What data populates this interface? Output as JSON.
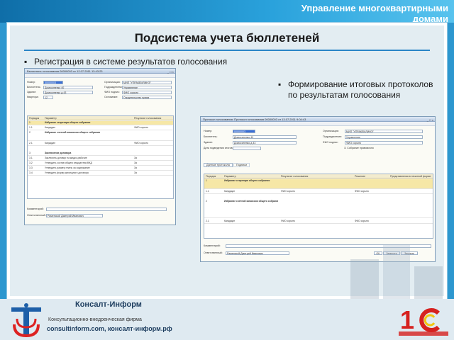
{
  "header": {
    "title": "Управление многоквартирными домами"
  },
  "slide": {
    "title": "Подсистема учета бюллетеней",
    "bullet1": "Регистрация в системе результатов голосования",
    "bullet2": "Формирование итоговых протоколов по результатам голосования"
  },
  "window1": {
    "title": "Бюллетень голосования 00000003 от 12.07.2011 13:43:23",
    "fields": [
      {
        "label": "Номер:",
        "value": "00000003"
      },
      {
        "label": "Бюллетень:",
        "value": "Домосипенко 40"
      },
      {
        "label": "Здание:",
        "value": "Домосипенко д.43"
      },
      {
        "label": "Квартира:",
        "value": "12"
      }
    ],
    "right_fields": [
      {
        "label": "Организация:",
        "value": "МИП \"УПРАКЕМЛИНЭ\""
      },
      {
        "label": "Подразделение:",
        "value": "Управление"
      },
      {
        "label": "ФИО подпис:",
        "value": "ФИО сорыто"
      },
      {
        "label": "Основание:",
        "value": "Свидетельство права"
      }
    ],
    "columns": [
      "Порядок",
      "Параметр",
      "Результат голосования"
    ],
    "rows": [
      {
        "num": "1",
        "text": "Избрание секретаря общего собрания"
      },
      {
        "num": "1.1",
        "text": "Кандидат",
        "result": "ФИО сорыто"
      },
      {
        "num": "2",
        "text": "Избрание счетной комиссии общего собрания"
      },
      {
        "num": "2.1",
        "text": "Кандидат",
        "result": "ФИО сорыто"
      },
      {
        "num": "3",
        "text": "Заключение договора"
      },
      {
        "num": "3.1",
        "text": "Заключить договор на жидко-рабочие",
        "result": "За"
      },
      {
        "num": "3.2",
        "text": "Утвердить состав общего имущества МКД",
        "result": "За"
      },
      {
        "num": "3.3",
        "text": "Утвердить размер платы за содержание",
        "result": "За"
      },
      {
        "num": "3.4",
        "text": "Утвердить форму жилищного договора",
        "result": "За"
      }
    ],
    "comment_label": "Комментарий:",
    "responsible_label": "Ответственный:",
    "responsible": "Раменской Дмитрий Иванович"
  },
  "window2": {
    "title": "Протокол голосования: Протокол голосования 00000003 от 13.07.2011 9:04:43",
    "fields": [
      {
        "label": "Номер:",
        "value": "00000003"
      },
      {
        "label": "Бюллетень:",
        "value": "Домосипенко 40"
      },
      {
        "label": "Здание:",
        "value": "Домосипенко д.43"
      },
      {
        "label": "Дата подведения итогов:",
        "value": ""
      }
    ],
    "right_fields": [
      {
        "label": "Организация:",
        "value": "МИП \"УПРАКЕМЛИНЭ\""
      },
      {
        "label": "Подразделение:",
        "value": "Управление"
      },
      {
        "label": "ФИО подпис:",
        "value": "ФИО сорыто"
      },
      {
        "label": "",
        "value": "Собрание правомочно"
      }
    ],
    "tabs": [
      "Данные протокола",
      "Подписи"
    ],
    "columns": [
      "Порядок",
      "Параметр",
      "Результат голосования",
      "Решение",
      "Представления в печатной форме"
    ],
    "rows": [
      {
        "num": "1",
        "text": "Избрание секретаря общего собрания"
      },
      {
        "num": "1.1",
        "text": "Кандидат",
        "result": "ФИО сорыто",
        "decision": "ФИО сорыто"
      },
      {
        "num": "2",
        "text": "Избрание счетной комиссии общего собрания"
      },
      {
        "num": "2.1",
        "text": "Кандидат",
        "result": "ФИО сорыто",
        "decision": "ФИО сорыто"
      }
    ],
    "comment_label": "Комментарий:",
    "responsible_label": "Ответственный:",
    "responsible": "Раменской Дмитрий Иванович",
    "buttons": [
      "OK",
      "Записать",
      "Закрыть"
    ]
  },
  "footer": {
    "brand": "Консалт-Информ",
    "company": "Консультационно-внедренческая фирма",
    "site": "consultinform.com, консалт-информ.рф"
  },
  "colors": {
    "accent": "#2a85c7",
    "background": "#2d97cf",
    "highlight": "#f6e7a6"
  }
}
